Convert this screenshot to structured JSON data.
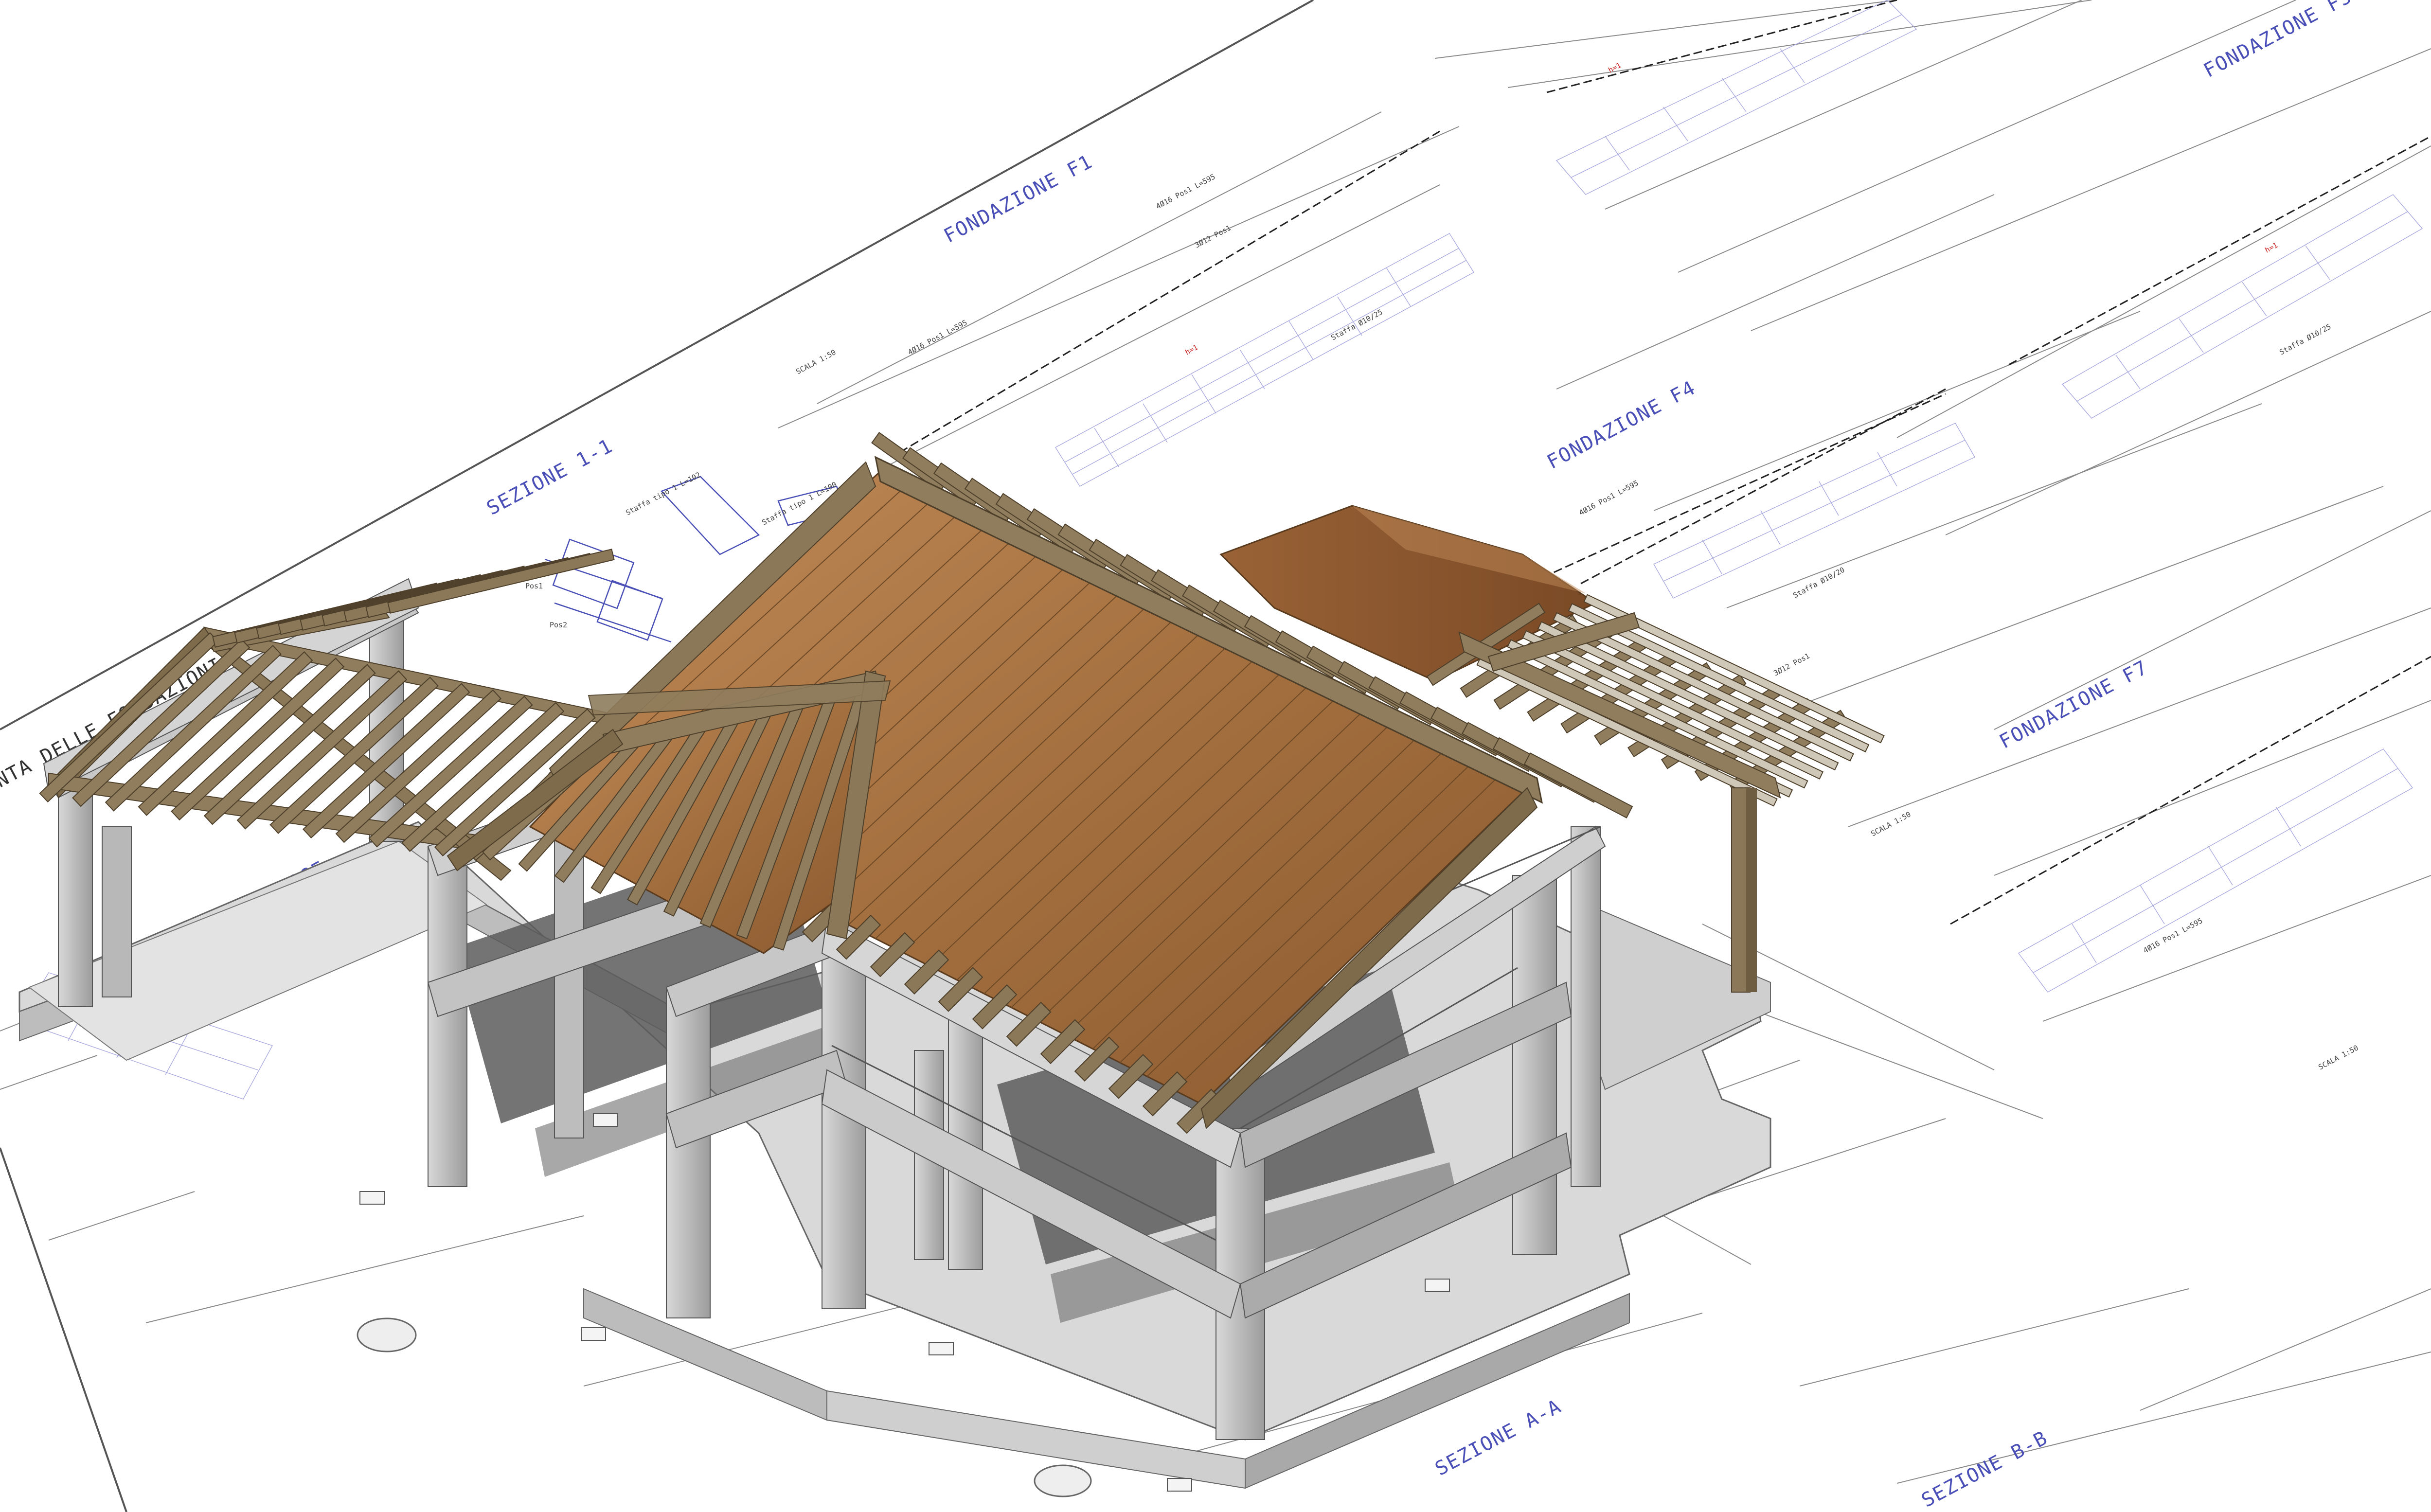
{
  "drawing": {
    "section_labels": [
      "FONDAZIONE F1",
      "FONDAZIONE F4",
      "FONDAZIONE F7",
      "FONDAZIONE F5",
      "SEZIONE 1-1",
      "SEZIONE A-A",
      "SEZIONE B-B",
      "NTA DELLE FONDAZIONI",
      "CORDOLO GARAGE"
    ],
    "annotations": [
      "SCALA 1:50",
      "Staffa tipo 1 L=102",
      "Staffa tipo 1 L=100",
      "4Ø16 Pos1 L=595",
      "3Ø12 Pos1",
      "Staffa Ø10/25",
      "Staffa Ø10/20",
      "Pos1",
      "Pos2",
      "h=1"
    ],
    "colors": {
      "concrete": "#c4c4c4",
      "wood_beam": "#8f7d5d",
      "roof_board": "#b07a4c",
      "annotation_blue": "#4a4fb8",
      "dimension_gray": "#8a8a8a"
    }
  }
}
